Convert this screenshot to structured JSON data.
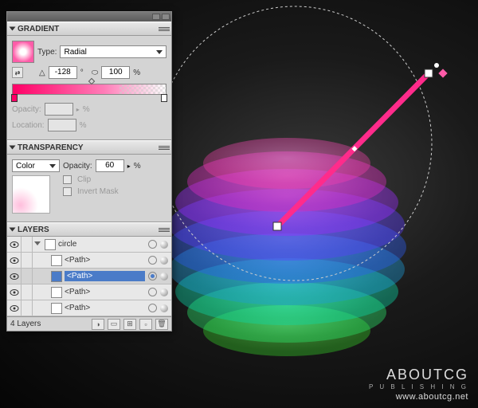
{
  "gradient": {
    "title": "GRADIENT",
    "type_label": "Type:",
    "type_value": "Radial",
    "angle_value": "-128",
    "angle_unit": "°",
    "aspect_value": "100",
    "aspect_unit": "%",
    "opacity_label": "Opacity:",
    "opacity_unit": "%",
    "location_label": "Location:",
    "location_unit": "%"
  },
  "transparency": {
    "title": "TRANSPARENCY",
    "blend_mode": "Color",
    "opacity_label": "Opacity:",
    "opacity_value": "60",
    "opacity_unit": "%",
    "clip_label": "Clip",
    "invert_label": "Invert Mask"
  },
  "layers": {
    "title": "LAYERS",
    "count_label": "4 Layers",
    "layer_name": "circle",
    "path_label": "<Path>",
    "selected_path": "<Path>"
  },
  "watermark": {
    "brand": "ABOUTCG",
    "publishing": "P U B L I S H I N G",
    "url": "www.aboutcg.net",
    "logo_text": "ABOUTCG"
  },
  "chart_data": {
    "type": "illustration",
    "description": "3D stacked translucent ellipses forming a sphere with rainbow gradient from magenta (top) through blue to green (bottom), with dashed selection circle and pink gradient annotator line"
  }
}
